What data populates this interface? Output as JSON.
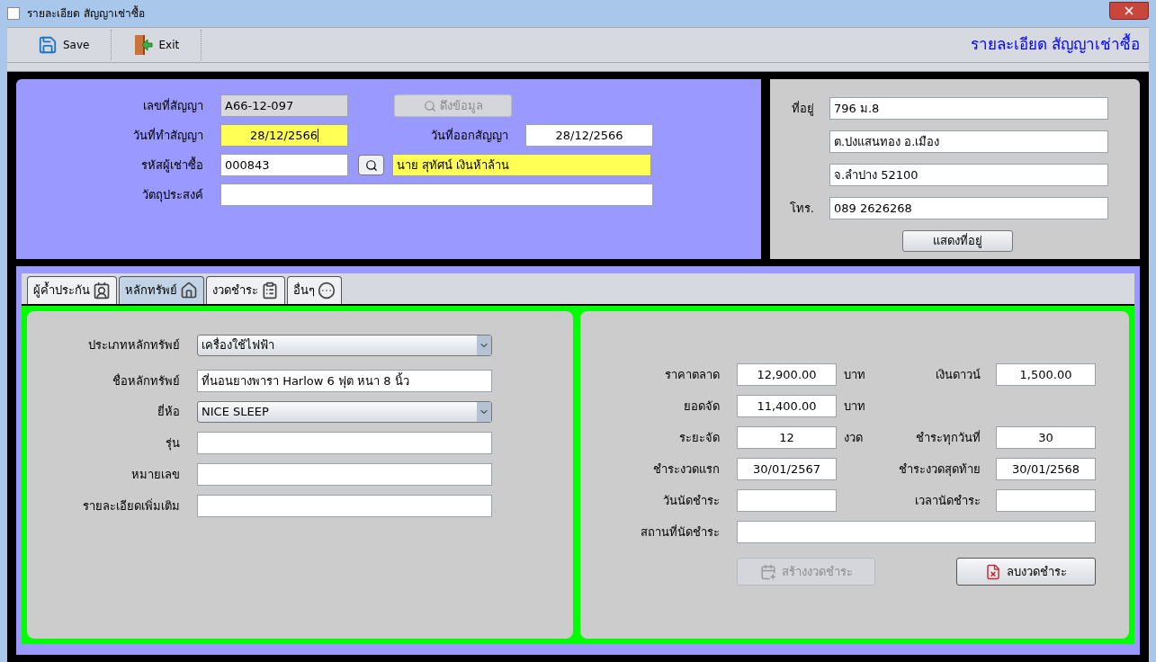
{
  "window": {
    "title": "รายละเอียด สัญญาเช่าซื้อ"
  },
  "toolbar": {
    "buttons": [
      {
        "label": "Save",
        "kind": "save"
      },
      {
        "label": "Exit",
        "kind": "exit"
      }
    ],
    "heading": "รายละเอียด สัญญาเช่าซื้อ"
  },
  "contract": {
    "number": {
      "label": "เลขที่สัญญา",
      "value": "A66-12-097",
      "disabled": true
    },
    "fetch_button": {
      "label": "ดึงข้อมูล",
      "disabled": true
    },
    "date": {
      "label": "วันที่ทำสัญญา",
      "value": "28/12/2566",
      "highlighted": true,
      "focused": true
    },
    "issue_date": {
      "label": "วันที่ออกสัญญา",
      "value": "28/12/2566"
    },
    "customer_code": {
      "label": "รหัสผู้เช่าซื้อ",
      "value": "000843"
    },
    "customer_name": {
      "value": "นาย สุทัศน์ เงินห้าล้าน",
      "highlighted": true
    },
    "purpose": {
      "label": "วัตถุประสงค์"
    }
  },
  "address": {
    "label": "ที่อยู่",
    "lines": [
      "796 ม.8",
      "ต.ปงแสนทอง อ.เมือง",
      "จ.ลำปาง 52100"
    ],
    "phone_label": "โทร.",
    "phone": "089 2626268",
    "button": "แสดงที่อยู่"
  },
  "tabs": [
    {
      "label": "ผู้ค้ำประกัน",
      "kind": "guarantor",
      "selected": false
    },
    {
      "label": "หลักทรัพย์",
      "kind": "asset",
      "selected": true
    },
    {
      "label": "งวดชำระ",
      "kind": "installment",
      "selected": false
    },
    {
      "label": "อื่นๆ",
      "kind": "more",
      "selected": false
    }
  ],
  "asset": {
    "fields": [
      {
        "label": "ประเภทหลักทรัพย์",
        "value": "เครื่องใช้ไฟฟ้า",
        "kind": "dropdown"
      },
      {
        "label": "ชื่อหลักทรัพย์",
        "value": "ที่นอนยางพารา Harlow 6 ฟุต หนา 8 นิ้ว",
        "kind": "text"
      },
      {
        "label": "ยี่ห้อ",
        "value": "NICE SLEEP",
        "kind": "dropdown"
      },
      {
        "label": "รุ่น",
        "kind": "text"
      },
      {
        "label": "หมายเลข",
        "kind": "text"
      },
      {
        "label": "รายละเอียดเพิ่มเติม",
        "kind": "text"
      }
    ]
  },
  "payment": {
    "rows": [
      {
        "left": {
          "label": "ราคาตลาด",
          "value": "12,900.00",
          "unit": "บาท"
        },
        "right": {
          "label": "เงินดาวน์",
          "value": "1,500.00"
        }
      },
      {
        "left": {
          "label": "ยอดจัด",
          "value": "11,400.00",
          "unit": "บาท"
        }
      },
      {
        "left": {
          "label": "ระยะจัด",
          "value": "12",
          "unit": "งวด"
        },
        "right": {
          "label": "ชำระทุกวันที่",
          "value": "30"
        }
      },
      {
        "left": {
          "label": "ชำระงวดแรก",
          "value": "30/01/2567"
        },
        "right": {
          "label": "ชำระงวดสุดท้าย",
          "value": "30/01/2568"
        }
      },
      {
        "left": {
          "label": "วันนัดชำระ"
        },
        "right": {
          "label": "เวลานัดชำระ"
        }
      }
    ],
    "place": {
      "label": "สถานที่นัดชำระ"
    },
    "buttons": [
      {
        "label": "สร้างงวดชำระ",
        "kind": "create",
        "disabled": true
      },
      {
        "label": "ลบงวดชำระ",
        "kind": "delete",
        "disabled": false
      }
    ]
  }
}
